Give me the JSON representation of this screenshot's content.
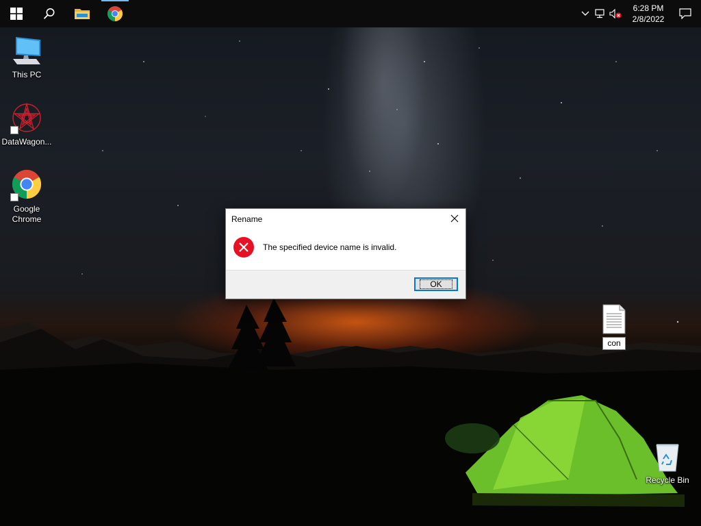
{
  "taskbar": {
    "pinned": [
      {
        "name": "start-button",
        "icon": "windows-logo-icon"
      },
      {
        "name": "search-button",
        "icon": "search-icon"
      },
      {
        "name": "file-explorer-button",
        "icon": "folder-icon"
      },
      {
        "name": "chrome-taskbar-button",
        "icon": "chrome-icon",
        "active": true
      }
    ],
    "tray": {
      "time": "6:28 PM",
      "date": "2/8/2022",
      "icons": [
        "chevron-up-icon",
        "network-icon",
        "volume-muted-icon"
      ]
    }
  },
  "desktop": {
    "icons": [
      {
        "label": "This PC",
        "icon": "computer-icon"
      },
      {
        "label": "DataWagon...",
        "icon": "datawagon-icon",
        "shortcut": true
      },
      {
        "label": "Google Chrome",
        "icon": "chrome-icon",
        "shortcut": true
      },
      {
        "label": "con",
        "icon": "text-file-icon",
        "renaming": true
      },
      {
        "label": "Recycle Bin",
        "icon": "recycle-bin-icon"
      }
    ]
  },
  "dialog": {
    "title": "Rename",
    "message": "The specified device name is invalid.",
    "ok_label": "OK",
    "icon": "error-icon",
    "error_color": "#e81123"
  },
  "colors": {
    "accent": "#0078d7",
    "taskbar_bg": "#0c0c0d"
  }
}
